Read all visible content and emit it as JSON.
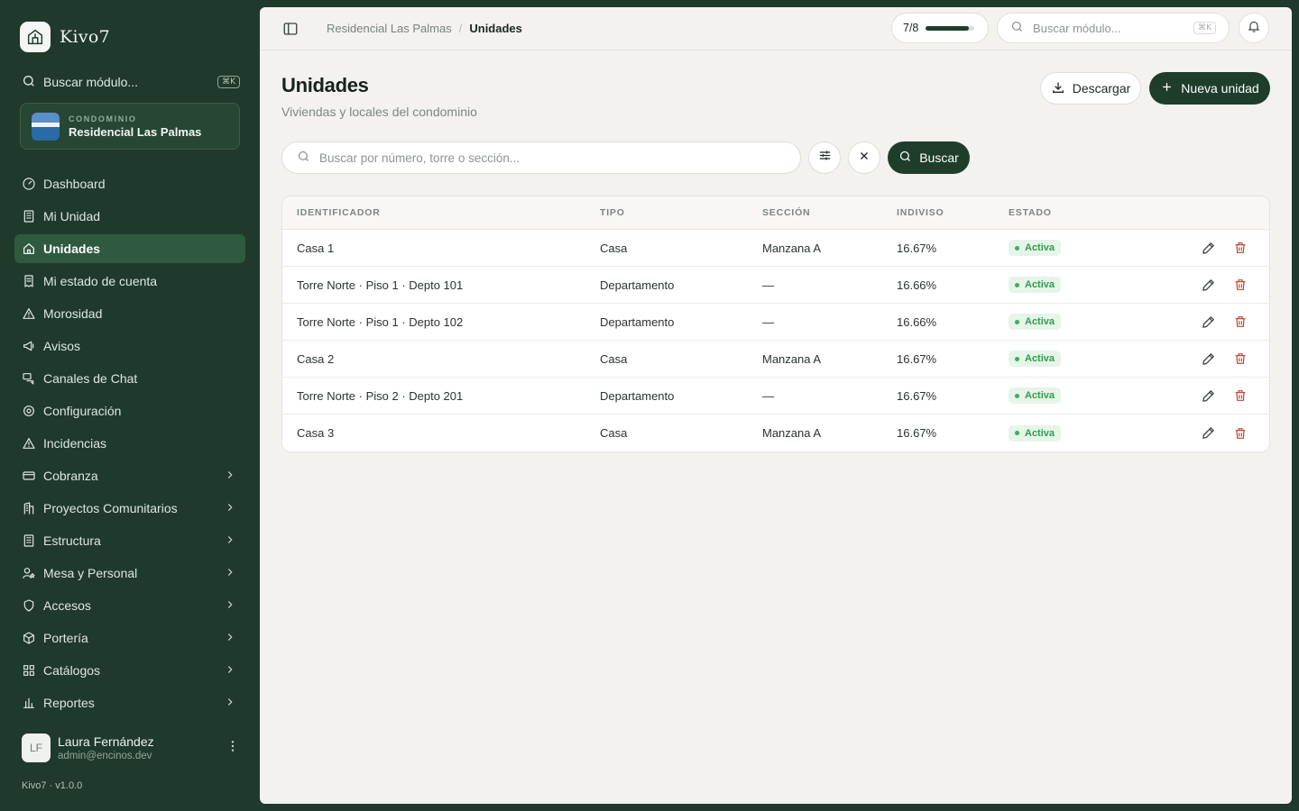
{
  "app": {
    "name": "Kivo7",
    "version": "Kivo7 · v1.0.0"
  },
  "sidebar": {
    "search_label": "Buscar módulo...",
    "search_shortcut": "⌘K",
    "condo": {
      "kicker": "CONDOMINIO",
      "name": "Residencial Las Palmas"
    },
    "items": [
      {
        "label": "Dashboard",
        "icon": "gauge-icon"
      },
      {
        "label": "Mi Unidad",
        "icon": "building-icon"
      },
      {
        "label": "Unidades",
        "icon": "home-icon",
        "active": true
      },
      {
        "label": "Mi estado de cuenta",
        "icon": "receipt-icon"
      },
      {
        "label": "Morosidad",
        "icon": "alert-triangle-icon"
      },
      {
        "label": "Avisos",
        "icon": "megaphone-icon"
      },
      {
        "label": "Canales de Chat",
        "icon": "chat-icon"
      },
      {
        "label": "Configuración",
        "icon": "gear-icon"
      },
      {
        "label": "Incidencias",
        "icon": "alert-triangle-icon"
      },
      {
        "label": "Cobranza",
        "icon": "credit-card-icon",
        "expandable": true
      },
      {
        "label": "Proyectos Comunitarios",
        "icon": "building-plus-icon",
        "expandable": true
      },
      {
        "label": "Estructura",
        "icon": "building-icon",
        "expandable": true
      },
      {
        "label": "Mesa y Personal",
        "icon": "user-star-icon",
        "expandable": true
      },
      {
        "label": "Accesos",
        "icon": "shield-icon",
        "expandable": true
      },
      {
        "label": "Portería",
        "icon": "box-icon",
        "expandable": true
      },
      {
        "label": "Catálogos",
        "icon": "grid-icon",
        "expandable": true
      },
      {
        "label": "Reportes",
        "icon": "bar-chart-icon",
        "expandable": true
      }
    ],
    "user": {
      "initials": "LF",
      "name": "Laura Fernández",
      "email": "admin@encinos.dev"
    }
  },
  "topbar": {
    "breadcrumb": [
      "Residencial Las Palmas",
      "Unidades"
    ],
    "progress": {
      "label": "7/8",
      "fraction": 0.875
    },
    "search_placeholder": "Buscar módulo...",
    "search_shortcut": "⌘K"
  },
  "page": {
    "title": "Unidades",
    "subtitle": "Viviendas y locales del condominio",
    "download_label": "Descargar",
    "new_label": "Nueva unidad",
    "filter_placeholder": "Buscar por número, torre o sección...",
    "search_button": "Buscar"
  },
  "table": {
    "columns": [
      "IDENTIFICADOR",
      "TIPO",
      "SECCIÓN",
      "INDIVISO",
      "ESTADO"
    ],
    "rows": [
      {
        "id": "Casa 1",
        "tipo": "Casa",
        "seccion": "Manzana A",
        "indiviso": "16.67%",
        "estado": "Activa"
      },
      {
        "id": "Torre Norte · Piso 1 · Depto 101",
        "tipo": "Departamento",
        "seccion": "—",
        "indiviso": "16.66%",
        "estado": "Activa"
      },
      {
        "id": "Torre Norte · Piso 1 · Depto 102",
        "tipo": "Departamento",
        "seccion": "—",
        "indiviso": "16.66%",
        "estado": "Activa"
      },
      {
        "id": "Casa 2",
        "tipo": "Casa",
        "seccion": "Manzana A",
        "indiviso": "16.67%",
        "estado": "Activa"
      },
      {
        "id": "Torre Norte · Piso 2 · Depto 201",
        "tipo": "Departamento",
        "seccion": "—",
        "indiviso": "16.67%",
        "estado": "Activa"
      },
      {
        "id": "Casa 3",
        "tipo": "Casa",
        "seccion": "Manzana A",
        "indiviso": "16.67%",
        "estado": "Activa"
      }
    ]
  },
  "colors": {
    "brand": "#1f3d2b",
    "sidebar_bg": "#1f3a2a",
    "active_badge": "#2f9e4a",
    "delete": "#c0432f"
  }
}
